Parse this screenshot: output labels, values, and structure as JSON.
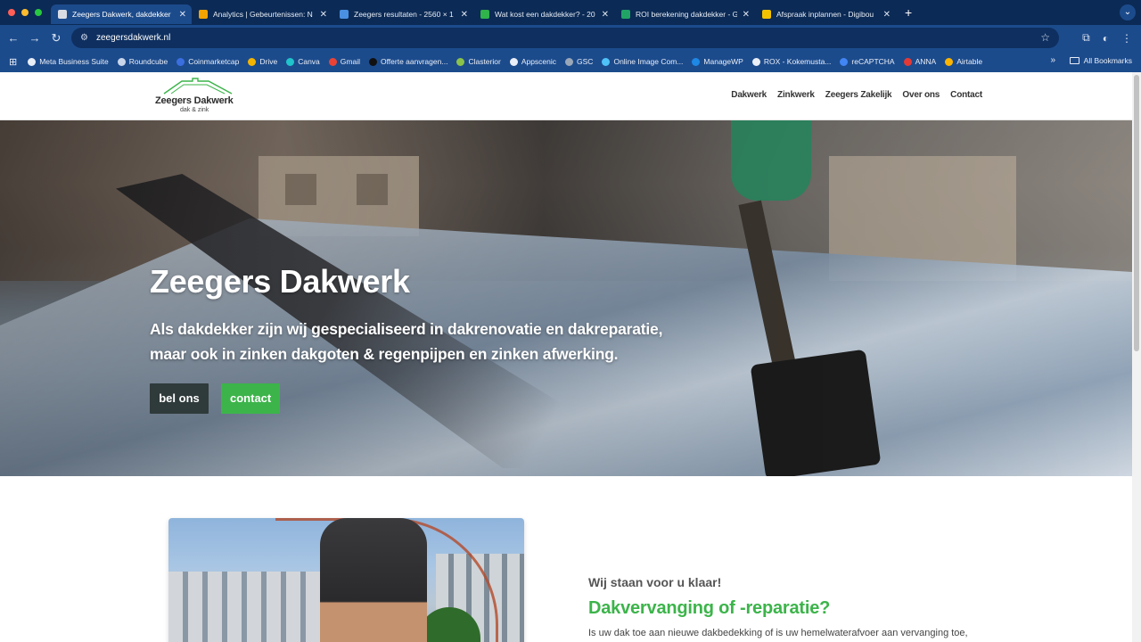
{
  "browser": {
    "traffic_colors": [
      "#ff5f57",
      "#febc2e",
      "#28c840"
    ],
    "tabs": [
      {
        "title": "Zeegers Dakwerk, dakdekker",
        "favicon_color": "#d9dde3",
        "active": true
      },
      {
        "title": "Analytics | Gebeurtenissen: N",
        "favicon_color": "#f4a300",
        "active": false
      },
      {
        "title": "Zeegers resultaten - 2560 × 1",
        "favicon_color": "#4a90e2",
        "active": false
      },
      {
        "title": "Wat kost een dakdekker? - 20",
        "favicon_color": "#2fb34a",
        "active": false
      },
      {
        "title": "ROI berekening dakdekker - G",
        "favicon_color": "#21a366",
        "active": false
      },
      {
        "title": "Afspraak inplannen - Digibou",
        "favicon_color": "#f2c200",
        "active": false
      }
    ],
    "new_tab": "+",
    "tab_menu": "⌄",
    "address": "zeegersdakwerk.nl",
    "back": "←",
    "forward": "→",
    "reload": "↻",
    "star": "☆",
    "extensions": "⧉",
    "menu": "⋮",
    "bookmarks": [
      {
        "label": "Meta Business Suite",
        "color": "#e9eef7"
      },
      {
        "label": "Roundcube",
        "color": "#c9d6ea"
      },
      {
        "label": "Coinmarketcap",
        "color": "#3b6fe0"
      },
      {
        "label": "Drive",
        "color": "#f4b400"
      },
      {
        "label": "Canva",
        "color": "#20c4cb"
      },
      {
        "label": "Gmail",
        "color": "#ea4335"
      },
      {
        "label": "Offerte aanvragen...",
        "color": "#111111"
      },
      {
        "label": "Clasterior",
        "color": "#8bc34a"
      },
      {
        "label": "Appscenic",
        "color": "#e9eef7"
      },
      {
        "label": "GSC",
        "color": "#9aa7b8"
      },
      {
        "label": "Online Image Com...",
        "color": "#4fc3f7"
      },
      {
        "label": "ManageWP",
        "color": "#1e88e5"
      },
      {
        "label": "ROX - Kokemusta...",
        "color": "#e9eef7"
      },
      {
        "label": "reCAPTCHA",
        "color": "#4285f4"
      },
      {
        "label": "ANNA",
        "color": "#e53935"
      },
      {
        "label": "Airtable",
        "color": "#fcb400"
      }
    ],
    "bookmarks_more": "»",
    "all_bookmarks": "All Bookmarks"
  },
  "site": {
    "logo_name": "Zeegers Dakwerk",
    "logo_sub": "dak & zink",
    "nav": [
      "Dakwerk",
      "Zinkwerk",
      "Zeegers Zakelijk",
      "Over ons",
      "Contact"
    ],
    "hero": {
      "title": "Zeegers Dakwerk",
      "text": "Als dakdekker zijn wij gespecialiseerd in dakrenovatie en dakreparatie, maar ook in zinken dakgoten & regenpijpen en zinken afwerking.",
      "btn_call": "bel ons",
      "btn_contact": "contact"
    },
    "section": {
      "kicker": "Wij staan voor u klaar!",
      "title": "Dakvervanging of -reparatie?",
      "text": "Is uw dak toe aan nieuwe dakbedekking of is uw hemelwaterafvoer aan vervanging toe,"
    },
    "accent_color": "#3cb44a"
  }
}
